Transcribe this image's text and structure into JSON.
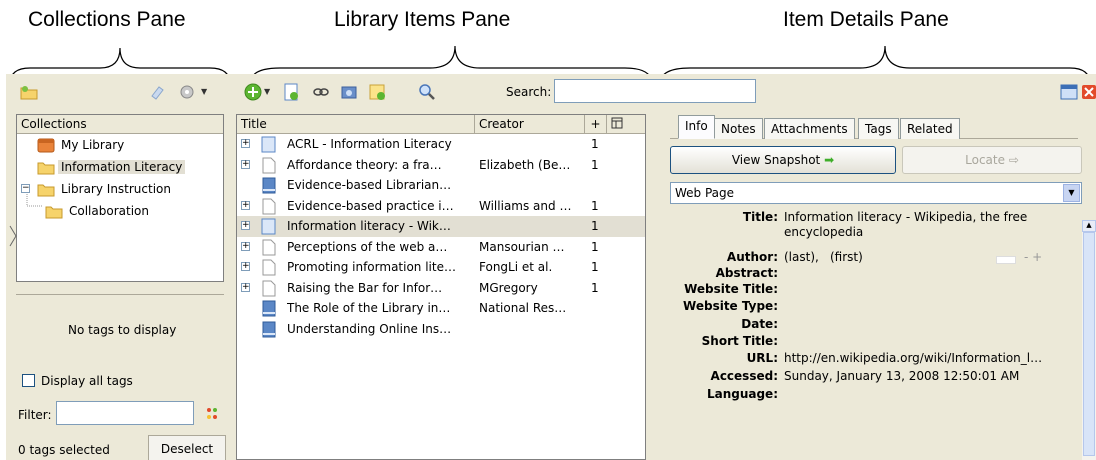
{
  "annotations": {
    "collections_pane": "Collections Pane",
    "library_items_pane": "Library Items Pane",
    "item_details_pane": "Item Details Pane"
  },
  "toolbar": {
    "search_label": "Search:",
    "search_value": ""
  },
  "collections": {
    "header": "Collections",
    "items": [
      {
        "label": "My Library"
      },
      {
        "label": "Information Literacy"
      },
      {
        "label": "Library Instruction"
      },
      {
        "label": "Collaboration"
      }
    ]
  },
  "tags": {
    "no_tags_text": "No tags to display",
    "display_all_label": "Display all tags",
    "filter_label": "Filter:",
    "filter_value": "",
    "selected_count_text": "0 tags selected",
    "deselect_label": "Deselect"
  },
  "items": {
    "headers": {
      "title": "Title",
      "creator": "Creator",
      "plus": "+"
    },
    "rows": [
      {
        "title": "ACRL - Information Literacy",
        "creator": "",
        "count": "1"
      },
      {
        "title": "Affordance theory: a fra…",
        "creator": "Elizabeth (Be…",
        "count": "1"
      },
      {
        "title": "Evidence-based Librarian…",
        "creator": "",
        "count": ""
      },
      {
        "title": "Evidence-based practice i…",
        "creator": "Williams and …",
        "count": "1"
      },
      {
        "title": "Information literacy - Wik…",
        "creator": "",
        "count": "1"
      },
      {
        "title": "Perceptions of the web a…",
        "creator": "Mansourian …",
        "count": "1"
      },
      {
        "title": "Promoting information lite…",
        "creator": "FongLi et al.",
        "count": "1"
      },
      {
        "title": "Raising the Bar for Infor…",
        "creator": "MGregory",
        "count": "1"
      },
      {
        "title": "The Role of the Library in…",
        "creator": "National Res…",
        "count": ""
      },
      {
        "title": "Understanding Online Ins…",
        "creator": "",
        "count": ""
      }
    ]
  },
  "details": {
    "tabs": [
      "Info",
      "Notes",
      "Attachments",
      "Tags",
      "Related"
    ],
    "view_snapshot_label": "View Snapshot",
    "locate_label": "Locate",
    "item_type": "Web Page",
    "fields": {
      "title_label": "Title:",
      "title_value": "Information literacy - Wikipedia, the free encyclopedia",
      "author_label": "Author:",
      "author_last": "(last),",
      "author_first": "(first)",
      "abstract_label": "Abstract:",
      "website_title_label": "Website Title:",
      "website_type_label": "Website Type:",
      "date_label": "Date:",
      "short_title_label": "Short Title:",
      "url_label": "URL:",
      "url_value": "http://en.wikipedia.org/wiki/Information_l…",
      "accessed_label": "Accessed:",
      "accessed_value": "Sunday, January 13, 2008 12:50:01 AM",
      "language_label": "Language:"
    },
    "author_controls": "- +"
  }
}
